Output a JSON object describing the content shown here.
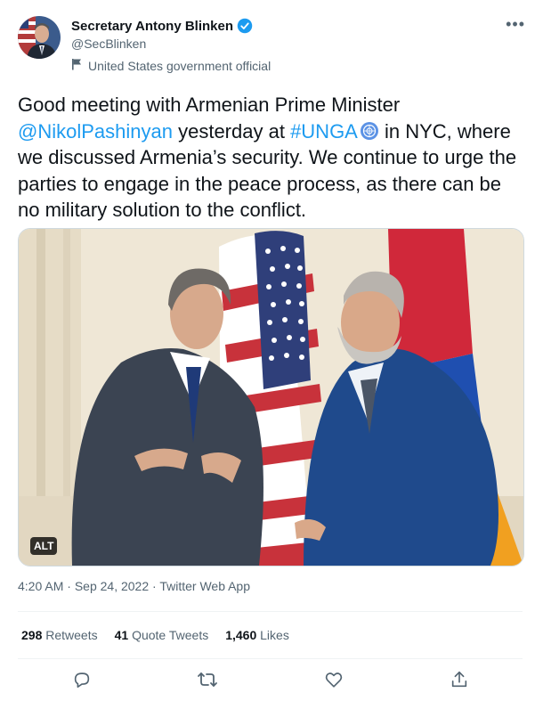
{
  "author": {
    "display_name": "Secretary Antony Blinken",
    "handle": "@SecBlinken",
    "label": "United States government official",
    "verified_icon": "verified-badge-icon"
  },
  "tweet": {
    "text_1": "Good meeting with Armenian Prime Minister ",
    "mention": "@NikolPashinyan",
    "text_2": " yesterday at ",
    "hashtag": "#UNGA",
    "text_3": " in NYC, where we discussed Armenia’s security. We continue to urge the parties to engage in the peace process, as there can be no military solution to the conflict."
  },
  "media": {
    "alt_badge": "ALT"
  },
  "meta": {
    "time": "4:20 AM",
    "separator1": " · ",
    "date": "Sep 24, 2022",
    "separator2": " · ",
    "source": "Twitter Web App"
  },
  "stats": {
    "retweets_count": "298",
    "retweets_label": " Retweets",
    "quotes_count": "41",
    "quotes_label": " Quote Tweets",
    "likes_count": "1,460",
    "likes_label": " Likes"
  },
  "actions": [
    "reply-icon",
    "retweet-icon",
    "like-icon",
    "share-icon"
  ],
  "colors": {
    "link": "#1d9bf0",
    "secondary_text": "#536471",
    "primary_text": "#0f1419"
  }
}
